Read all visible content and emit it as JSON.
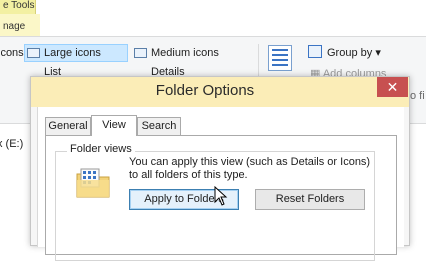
{
  "ribbon": {
    "context_tab": "e Tools",
    "manage_tab": "nage",
    "layout_items": {
      "row1_left": "icons",
      "large_icons": "Large icons",
      "medium_icons": "Medium icons",
      "row2_list": "List",
      "row2_details": "Details"
    },
    "group_by": "Group by",
    "group_by_arrow": "▾",
    "add_columns": "Add columns",
    "size_fit": "o fi"
  },
  "explorer": {
    "drive_label": "x (E:)"
  },
  "dialog": {
    "title": "Folder Options",
    "close_glyph": "✕",
    "tabs": [
      "General",
      "View",
      "Search"
    ],
    "active_tab": "View",
    "group_title": "Folder views",
    "description": "You can apply this view (such as Details or Icons) to all folders of this type.",
    "apply_button": "Apply to Folders",
    "reset_button": "Reset Folders"
  },
  "colors": {
    "accent_selected": "#cce8ff",
    "close_button": "#c75050",
    "dialog_frame": "#fbedb7",
    "context_tab": "#f3f0a2"
  },
  "icons": [
    "folder-view-icon",
    "close-icon",
    "cursor-icon",
    "group-by-icon",
    "add-columns-icon"
  ]
}
